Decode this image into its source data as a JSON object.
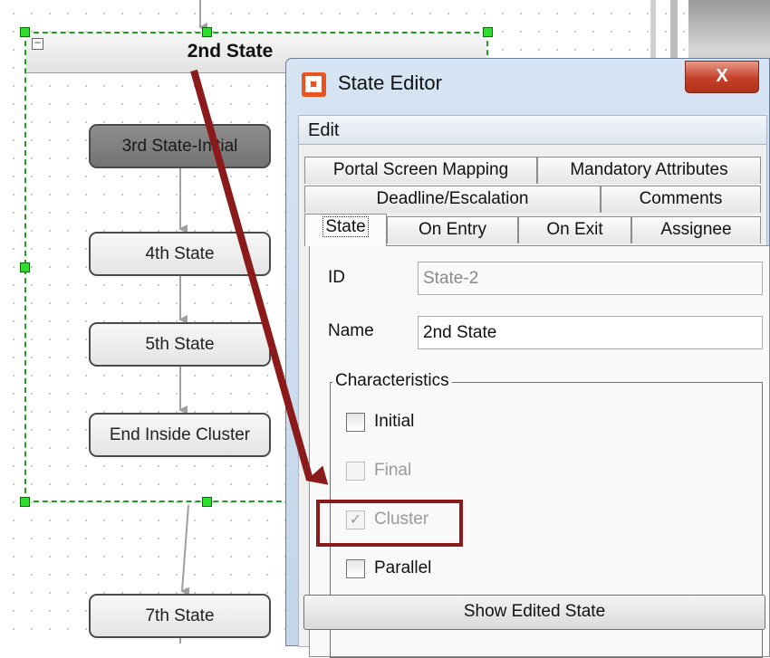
{
  "diagram": {
    "cluster_title": "2nd State",
    "nodes": [
      {
        "label": "3rd State-Initial",
        "initial": true
      },
      {
        "label": "4th State"
      },
      {
        "label": "5th State"
      },
      {
        "label": "End Inside Cluster"
      },
      {
        "label": "7th State"
      }
    ]
  },
  "dialog": {
    "title": "State Editor",
    "close_symbol": "X",
    "menu": {
      "edit": "Edit"
    },
    "tabs": {
      "row1": [
        "Portal Screen Mapping",
        "Mandatory Attributes"
      ],
      "row2": [
        "Deadline/Escalation",
        "Comments"
      ],
      "row3": [
        "State",
        "On Entry",
        "On Exit",
        "Assignee"
      ],
      "active": "State"
    },
    "fields": {
      "id_label": "ID",
      "id_value": "State-2",
      "name_label": "Name",
      "name_value": "2nd State"
    },
    "characteristics": {
      "legend": "Characteristics",
      "options": [
        {
          "label": "Initial",
          "checked": false,
          "enabled": true
        },
        {
          "label": "Final",
          "checked": false,
          "enabled": false
        },
        {
          "label": "Cluster",
          "checked": true,
          "enabled": false
        },
        {
          "label": "Parallel",
          "checked": false,
          "enabled": true
        }
      ]
    },
    "show_button": "Show Edited State"
  },
  "annotation": {
    "color": "#8b1a1a"
  }
}
